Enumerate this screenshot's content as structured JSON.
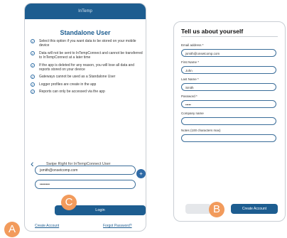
{
  "left": {
    "header": "InTemp",
    "title": "Standalone User",
    "bullets": [
      "Select this option if you want data to be stored on your mobile device",
      "Data will not be sent to InTempConnect and cannot be transferred to InTempConnect at a later time",
      "If the app is deleted for any reason, you will lose all data and reports stored on your device",
      "Gateways cannot be used as a Standalone User",
      "Logger profiles are create in the app",
      "Reports can only be accessed via the app"
    ],
    "swipe_text": "Swipe Right for InTempConnect User",
    "email_value": "jsmith@onsetcomp.com",
    "password_value": "••••••••",
    "login_label": "Login",
    "create_account": "Create Account",
    "forgot_password": "Forgot Password?"
  },
  "right": {
    "title": "Tell us about yourself",
    "fields": [
      {
        "label": "Email address *",
        "value": "jsmith@onsetcomp.com"
      },
      {
        "label": "First Name *",
        "value": "John"
      },
      {
        "label": "Last Name *",
        "value": "Smith"
      },
      {
        "label": "Password *",
        "value": "•••••"
      },
      {
        "label": "Company name",
        "value": ""
      },
      {
        "label": "Notes (100 characters max)",
        "value": ""
      }
    ],
    "create_account_label": "Create Account"
  },
  "badges": {
    "a": "A",
    "b": "B",
    "c": "C"
  },
  "colors": {
    "primary": "#1d5d90",
    "badge": "#f29b5c"
  }
}
